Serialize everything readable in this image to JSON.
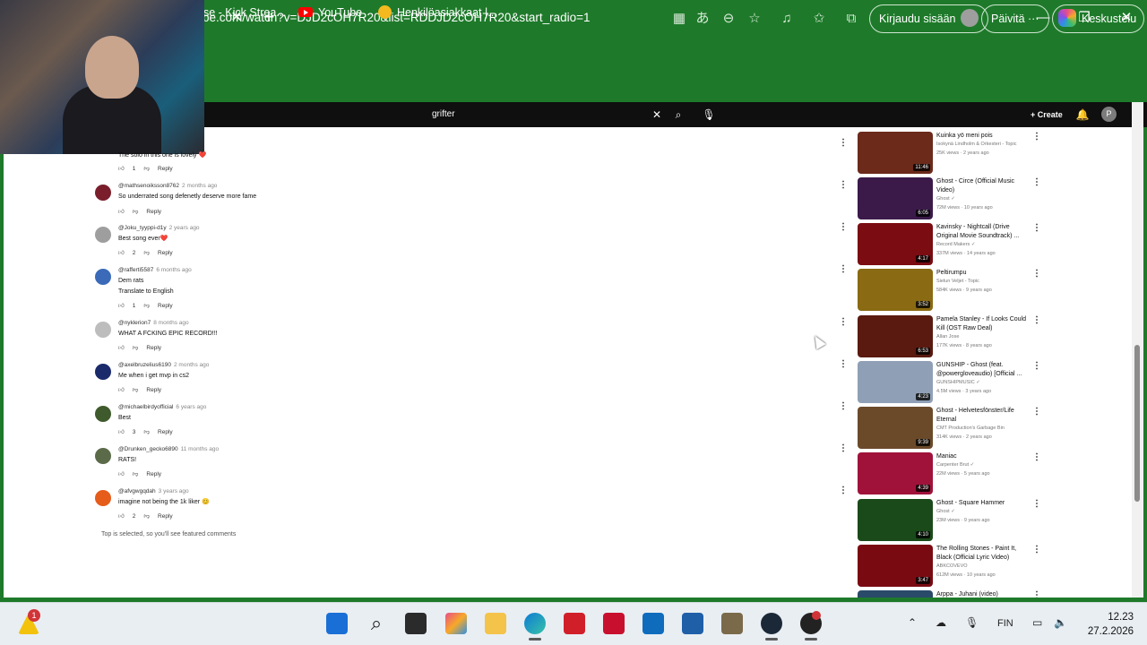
{
  "browser": {
    "url": "be.com/watch?v=DJD2cOH7R20&list=RDDJD2cOH7R20&start_radio=1",
    "signin_label": "Kirjaudu sisään",
    "update_label": "Päivitä",
    "copilot_label": "Keskustelu",
    "bookmarks": [
      {
        "label": "se - Kick Strea..."
      },
      {
        "label": "YouTube"
      },
      {
        "label": "Henkilöasiakkaat |..."
      }
    ]
  },
  "youtube": {
    "search_value": "grifter",
    "create_label": "Create",
    "avatar_letter": "P",
    "comments": [
      {
        "author": "",
        "ago": "",
        "text": "The solo in this one is lovely ❤️",
        "likes": "1",
        "reply": "Reply",
        "avatar_color": "#b3001b"
      },
      {
        "author": "@mathsenoiksson8762",
        "ago": "2 months ago",
        "text": "So underrated song defenetly deserve more fame",
        "likes": "",
        "reply": "Reply",
        "avatar_color": "#7a1e2c"
      },
      {
        "author": "@Joku_tyyppi-d1y",
        "ago": "2 years ago",
        "text": "Best song ever❤️",
        "likes": "2",
        "reply": "Reply",
        "avatar_color": "#9e9e9e"
      },
      {
        "author": "@rafferti5587",
        "ago": "6 months ago",
        "text": "Dem rats",
        "text2": "Translate to English",
        "likes": "1",
        "reply": "Reply",
        "avatar_color": "#3a6ab8"
      },
      {
        "author": "@nyklerion7",
        "ago": "8 months ago",
        "text": "WHAT A FCKING EPIC RECORD!!!",
        "likes": "",
        "reply": "Reply",
        "avatar_color": "#bdbdbd"
      },
      {
        "author": "@axelbruzelius6190",
        "ago": "2 months ago",
        "text": "Me when i get mvp in cs2",
        "likes": "",
        "reply": "Reply",
        "avatar_color": "#1a2a6b"
      },
      {
        "author": "@michaelbirdyofficial",
        "ago": "6 years ago",
        "text": "Best",
        "likes": "3",
        "reply": "Reply",
        "avatar_color": "#3f5a2c"
      },
      {
        "author": "@Drunken_gecko6890",
        "ago": "11 months ago",
        "text": "RATS!",
        "likes": "",
        "reply": "Reply",
        "avatar_color": "#5b6b4a"
      },
      {
        "author": "@afvgwgqdah",
        "ago": "3 years ago",
        "text": "imagine not being the 1k liker 😊",
        "likes": "2",
        "reply": "Reply",
        "avatar_color": "#e65c1a"
      }
    ],
    "featured_note": "Top is selected, so you'll see featured comments",
    "videos": [
      {
        "title": "Kuinka yö meni pois",
        "channel": "Isokynä Lindholm & Orkesteri - Topic",
        "meta": "25K views · 2 years ago",
        "duration": "11:46",
        "thumb": "#6b2a1a"
      },
      {
        "title": "Ghost - Circe (Official Music Video)",
        "channel": "Ghost ✓",
        "meta": "72M views · 10 years ago",
        "duration": "6:05",
        "thumb": "#3b1a4a"
      },
      {
        "title": "Kavinsky - Nightcall (Drive Original Movie Soundtrack) ...",
        "channel": "Record Makers ✓",
        "meta": "337M views · 14 years ago",
        "duration": "4:17",
        "thumb": "#7a0c12"
      },
      {
        "title": "Peltirumpu",
        "channel": "Sielun Veljet - Topic",
        "meta": "584K views · 9 years ago",
        "duration": "3:52",
        "thumb": "#8a6a12"
      },
      {
        "title": "Pamela Stanley - If Looks Could Kill (OST Raw Deal)",
        "channel": "Allan Jose",
        "meta": "177K views · 8 years ago",
        "duration": "6:53",
        "thumb": "#5a1a10"
      },
      {
        "title": "GUNSHIP - Ghost (feat. @powergloveaudio) [Official ...",
        "channel": "GUNSHIPMUSIC ✓",
        "meta": "4.5M views · 3 years ago",
        "duration": "4:23",
        "thumb": "#8fa0b6"
      },
      {
        "title": "Ghost - Helvetesfönster/Life Eternal",
        "channel": "CMT Production's Garbage Bin",
        "meta": "314K views · 2 years ago",
        "duration": "9:39",
        "thumb": "#6b4a2a"
      },
      {
        "title": "Maniac",
        "channel": "Carpenter Brut ✓",
        "meta": "22M views · 5 years ago",
        "duration": "4:39",
        "thumb": "#a0123a"
      },
      {
        "title": "Ghost - Square Hammer",
        "channel": "Ghost ✓",
        "meta": "23M views · 9 years ago",
        "duration": "4:10",
        "thumb": "#1a4a1a"
      },
      {
        "title": "The Rolling Stones - Paint It, Black (Official Lyric Video)",
        "channel": "ABKCOVEVO",
        "meta": "612M views · 10 years ago",
        "duration": "3:47",
        "thumb": "#7a0a12"
      },
      {
        "title": "Arppa - Juhani (video)",
        "channel": "",
        "meta": "",
        "duration": "",
        "thumb": "#2a4a6a"
      }
    ]
  },
  "taskbar": {
    "alert_badge": "1",
    "language": "FIN",
    "time": "12.23",
    "date": "27.2.2026"
  }
}
